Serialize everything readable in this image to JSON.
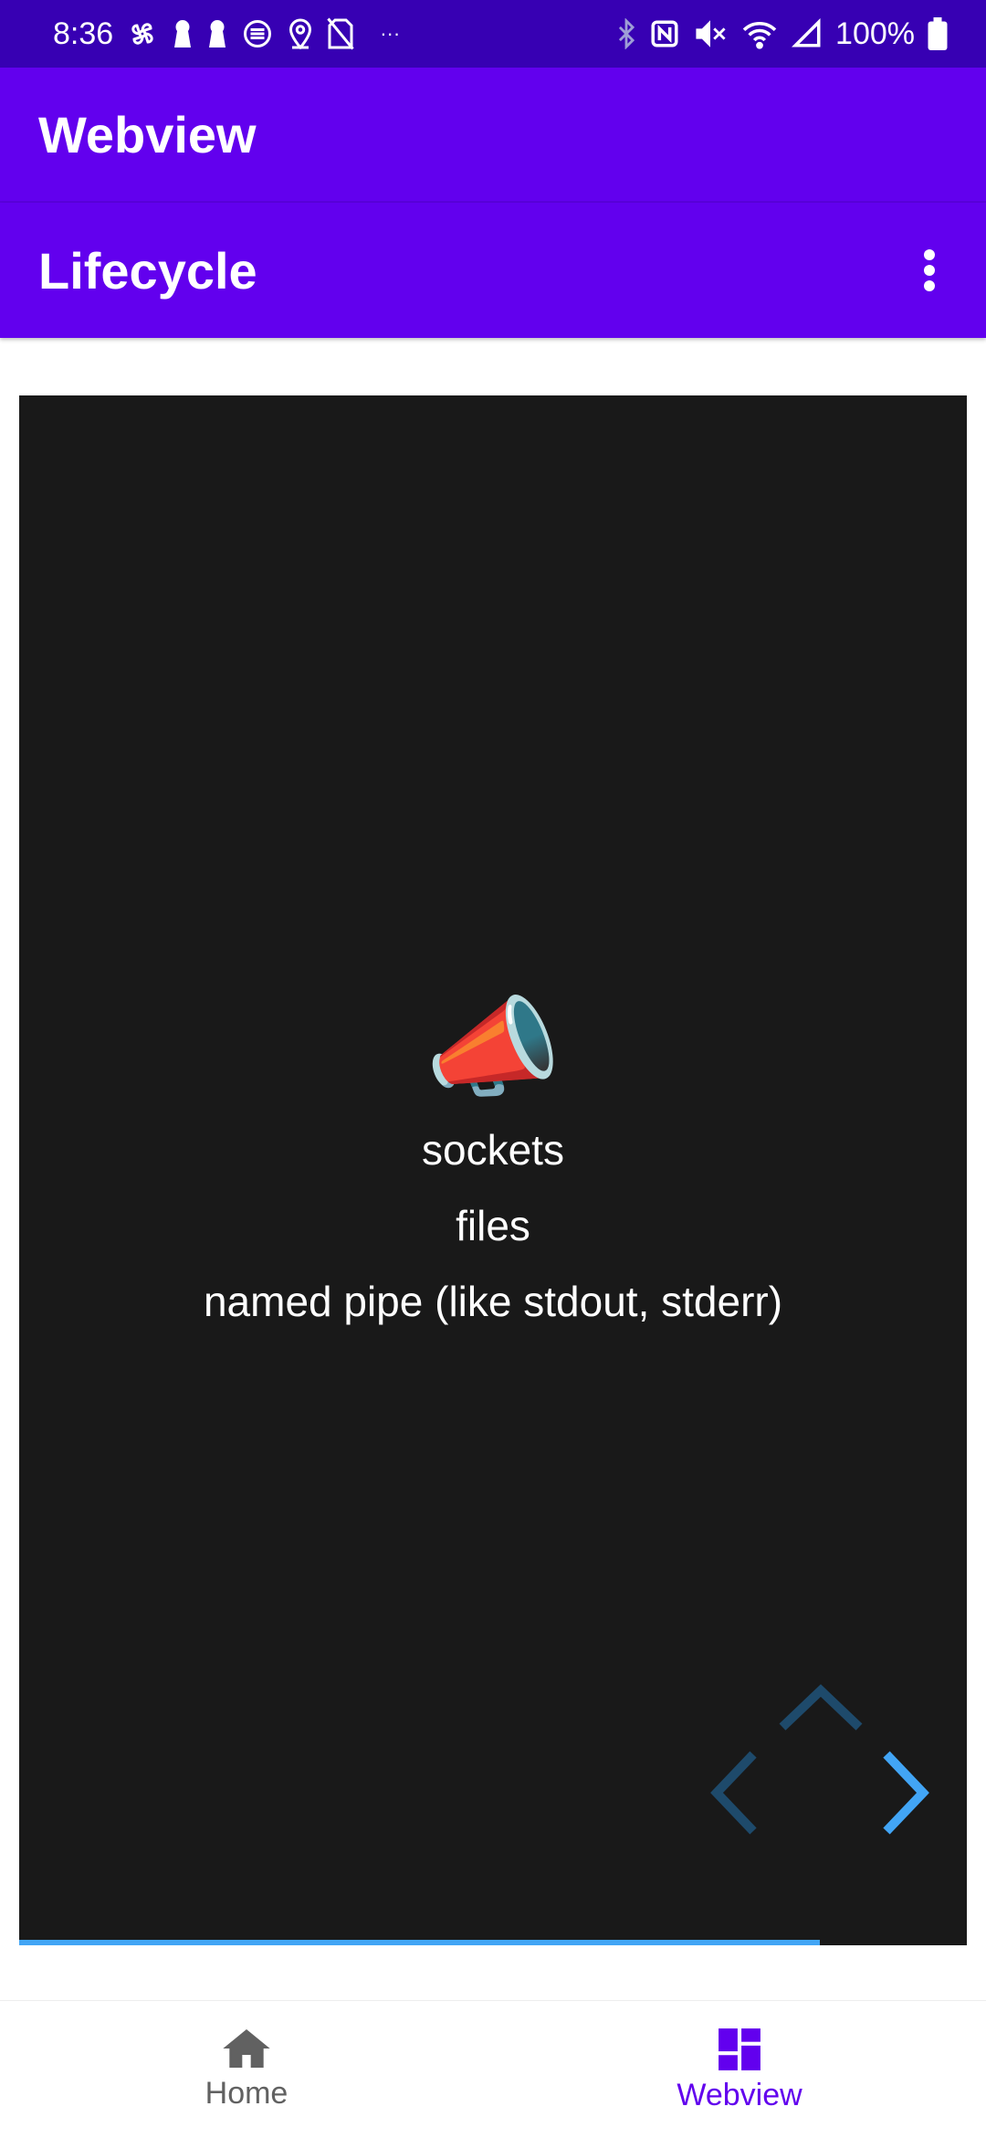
{
  "status_bar": {
    "time": "8:36",
    "battery": "100%"
  },
  "app_bar": {
    "title": "Webview"
  },
  "toolbar": {
    "title": "Lifecycle",
    "overflow_icon": "more-vert-icon"
  },
  "slide": {
    "icon": "megaphone-icon",
    "emoji": "📣",
    "lines": [
      "sockets",
      "files",
      "named pipe (like stdout, stderr)"
    ],
    "progress": 0.845
  },
  "bottom_nav": {
    "items": [
      {
        "label": "Home",
        "icon": "home-icon",
        "selected": false
      },
      {
        "label": "Webview",
        "icon": "dashboard-icon",
        "selected": true
      }
    ]
  },
  "colors": {
    "status_bar": "#3700b3",
    "primary": "#6200ee",
    "slide_bg": "#191919",
    "accent_blue": "#42a5f5",
    "muted_blue": "#1e4a6b",
    "nav_inactive": "#616161"
  }
}
